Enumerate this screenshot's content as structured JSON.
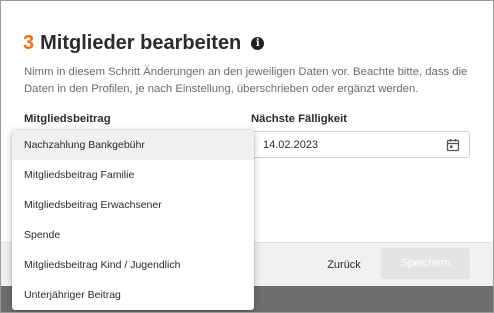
{
  "dialog": {
    "step_number": "3",
    "title": "Mitglieder bearbeiten",
    "info_icon": "info-icon",
    "description": "Nimm in diesem Schritt Änderungen an den jeweiligen Daten vor. Beachte bitte, dass die Daten in den Profilen, je nach Einstellung, überschrieben oder ergänzt werden."
  },
  "form": {
    "membership_fee_label": "Mitgliedsbeitrag",
    "next_due_label": "Nächste Fälligkeit",
    "next_due_value": "14.02.2023",
    "calendar_icon": "calendar-icon"
  },
  "dropdown": {
    "options": [
      "Nachzahlung Bankgebühr",
      "Mitgliedsbeitrag Familie",
      "Mitgliedsbeitrag Erwachsener",
      "Spende",
      "Mitgliedsbeitrag Kind / Jugendlich",
      "Unterjähriger Beitrag"
    ]
  },
  "footer": {
    "back_label": "Zurück",
    "save_label": "Speichern"
  },
  "colors": {
    "accent": "#e8711a",
    "save_disabled_bg": "#e4e4e4",
    "footer_bg": "#f1f1f1"
  }
}
